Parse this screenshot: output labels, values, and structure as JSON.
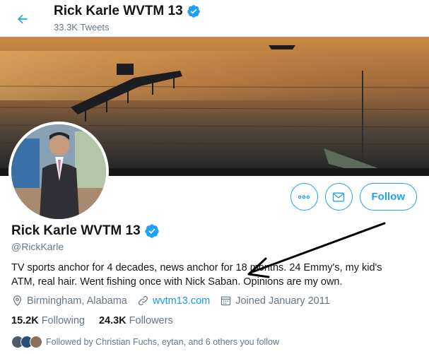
{
  "header": {
    "name": "Rick Karle WVTM 13",
    "tweets": "33.3K Tweets",
    "back_icon": "arrow-left-icon",
    "verified_icon": "verified-badge-icon"
  },
  "profile": {
    "name": "Rick Karle WVTM 13",
    "handle": "@RickKarle",
    "bio": "TV sports anchor for 4 decades, news anchor for 18 months. 24 Emmy's, my kid's ATM, real hair. Went fishing once with Nick Saban. Opinions are my own.",
    "location": "Birmingham, Alabama",
    "website": "wvtm13.com",
    "joined": "Joined January 2011",
    "following_count": "15.2K",
    "following_label": "Following",
    "followers_count": "24.3K",
    "followers_label": "Followers",
    "followed_by": "Followed by Christian Fuchs, eytan, and 6 others you follow"
  },
  "actions": {
    "more_icon": "more-dots-icon",
    "message_icon": "envelope-icon",
    "follow_label": "Follow"
  },
  "colors": {
    "accent": "#1da1f2",
    "link": "#1b95e0",
    "muted": "#657786",
    "text": "#14171a"
  }
}
